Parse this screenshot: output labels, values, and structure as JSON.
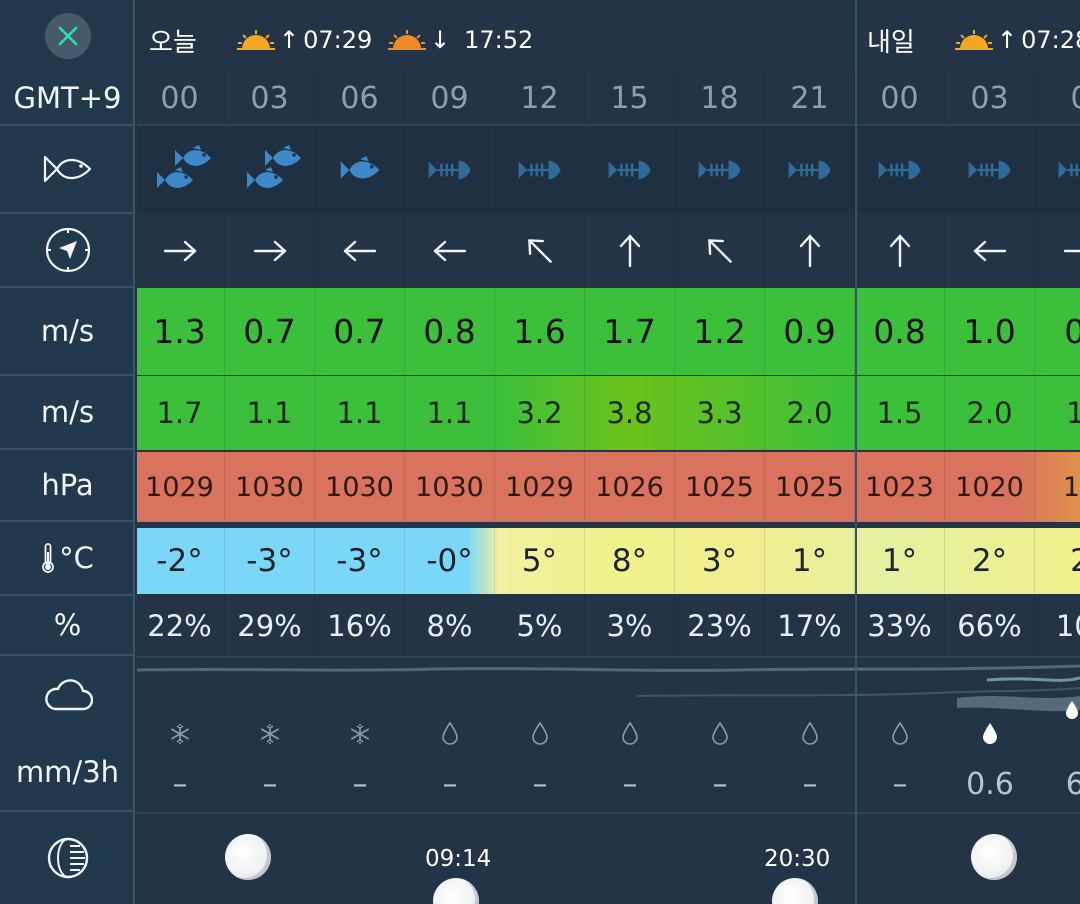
{
  "header": {
    "today_label": "오늘",
    "today_sunrise": "07:29",
    "today_sunset": "17:52",
    "tomorrow_label": "내일",
    "tomorrow_sunrise": "07:28"
  },
  "sidebar": {
    "timezone": "GMT+9",
    "wind_unit": "m/s",
    "gust_unit": "m/s",
    "pressure_unit": "hPa",
    "temp_unit": "°C",
    "humidity_unit": "%",
    "precip_unit": "mm/3h"
  },
  "columns": [
    {
      "hour": "00",
      "fish": "active2",
      "dir": "→",
      "wind": "1.3",
      "gust": "1.7",
      "pressure": "1029",
      "temp": "-2°",
      "humidity": "22%",
      "precip_icon": "snow",
      "precip": "–"
    },
    {
      "hour": "03",
      "fish": "active2",
      "dir": "→",
      "wind": "0.7",
      "gust": "1.1",
      "pressure": "1030",
      "temp": "-3°",
      "humidity": "29%",
      "precip_icon": "snow",
      "precip": "–"
    },
    {
      "hour": "06",
      "fish": "active1",
      "dir": "←",
      "wind": "0.7",
      "gust": "1.1",
      "pressure": "1030",
      "temp": "-3°",
      "humidity": "16%",
      "precip_icon": "snow",
      "precip": "–"
    },
    {
      "hour": "09",
      "fish": "bone",
      "dir": "←",
      "wind": "0.8",
      "gust": "1.1",
      "pressure": "1030",
      "temp": "-0°",
      "humidity": "8%",
      "precip_icon": "drop",
      "precip": "–"
    },
    {
      "hour": "12",
      "fish": "bone",
      "dir": "↖",
      "wind": "1.6",
      "gust": "3.2",
      "pressure": "1029",
      "temp": "5°",
      "humidity": "5%",
      "precip_icon": "drop",
      "precip": "–"
    },
    {
      "hour": "15",
      "fish": "bone",
      "dir": "↑",
      "wind": "1.7",
      "gust": "3.8",
      "pressure": "1026",
      "temp": "8°",
      "humidity": "3%",
      "precip_icon": "drop",
      "precip": "–"
    },
    {
      "hour": "18",
      "fish": "bone",
      "dir": "↖",
      "wind": "1.2",
      "gust": "3.3",
      "pressure": "1025",
      "temp": "3°",
      "humidity": "23%",
      "precip_icon": "drop",
      "precip": "–"
    },
    {
      "hour": "21",
      "fish": "bone",
      "dir": "↑",
      "wind": "0.9",
      "gust": "2.0",
      "pressure": "1025",
      "temp": "1°",
      "humidity": "17%",
      "precip_icon": "drop",
      "precip": "–"
    },
    {
      "hour": "00",
      "fish": "bone",
      "dir": "↑",
      "wind": "0.8",
      "gust": "1.5",
      "pressure": "1023",
      "temp": "1°",
      "humidity": "33%",
      "precip_icon": "drop",
      "precip": "–"
    },
    {
      "hour": "03",
      "fish": "bone",
      "dir": "←",
      "wind": "1.0",
      "gust": "2.0",
      "pressure": "1020",
      "temp": "2°",
      "humidity": "66%",
      "precip_icon": "drop-filled",
      "precip": "0.6"
    },
    {
      "hour": "0",
      "fish": "bone",
      "dir": "→",
      "wind": "0.",
      "gust": "1.",
      "pressure": "10",
      "temp": "2",
      "humidity": "10(",
      "precip_icon": "drops-filled",
      "precip": "6."
    }
  ],
  "moon": {
    "moonrise": "09:14",
    "moonset": "20:30"
  },
  "colors": {
    "background": "#233446",
    "wind_green": "#3cc03c",
    "pressure_red": "#d9735e",
    "temp_cold": "#7ad7f8",
    "temp_warm": "#f0f08c",
    "fish_active": "#3c88c8",
    "fish_inactive": "#2e6b99"
  }
}
